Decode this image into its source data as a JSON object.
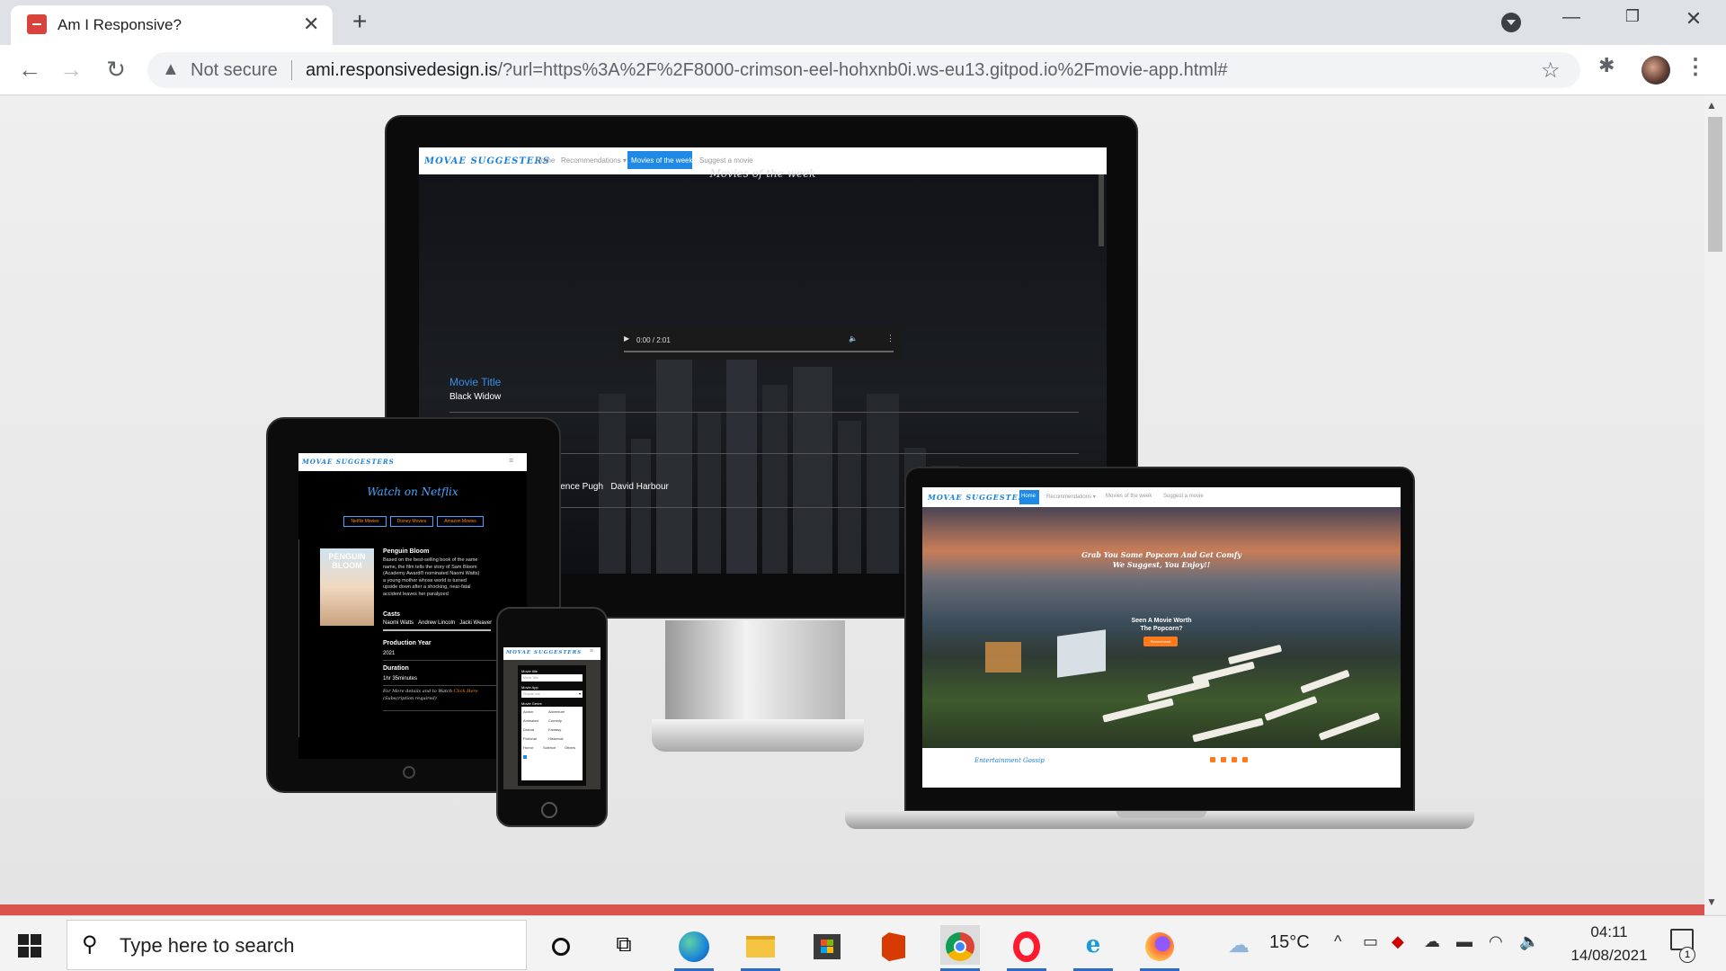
{
  "browser": {
    "tab_title": "Am I Responsive?",
    "tab_close": "✕",
    "new_tab": "+",
    "security_label": "Not secure",
    "url_host": "ami.responsivedesign.is",
    "url_path": "/?url=https%3A%2F%2F8000-crimson-eel-hohxnb0i.ws-eu13.gitpod.io%2Fmovie-app.html#",
    "icons": [
      "back-icon",
      "forward-icon",
      "reload-icon",
      "warning-icon",
      "star-icon",
      "extensions-icon",
      "menu-icon",
      "minimize-icon",
      "restore-icon",
      "close-icon"
    ]
  },
  "site": {
    "brand": "MOVAE SUGGESTERS",
    "nav": [
      "Home",
      "Recommendations ▾",
      "Movies of the week",
      "Suggest a movie"
    ],
    "monitor": {
      "heading": "Movies of the week",
      "video_time": "0:00 / 2:01",
      "movie_title_label": "Movie Title",
      "movie_title_value": "Black Widow",
      "cast": [
        "Florence Pugh",
        "David Harbour"
      ]
    },
    "tablet": {
      "heading": "Watch on Netflix",
      "pills": [
        "Netflix Movies",
        "Disney Movies",
        "Amazon Movies"
      ],
      "poster_text": "PENGUIN BLOOM",
      "film_title": "Penguin Bloom",
      "synopsis": "Based on the best-selling book of the same name, the film tells the story of Sam Bloom (Academy Award® nominated Naomi Watts) a young mother whose world is turned upside down after a shocking, near-fatal accident leaves her paralyzed",
      "casts_label": "Casts",
      "casts": [
        "Naomi Watts",
        "Andrew Lincoln",
        "Jacki Weaver"
      ],
      "year_label": "Production Year",
      "year": "2021",
      "duration_label": "Duration",
      "duration": "1hr 35minutes",
      "more_prefix": "For More details and to Watch ",
      "more_link": "Click Here",
      "more_suffix": "(Subscription required)"
    },
    "phone": {
      "title_label": "Movie title",
      "title_placeholder": "Movie Title",
      "app_label": "Movie App",
      "app_placeholder": "Choose one",
      "genre_label": "Movie Genre",
      "genres": [
        "Action",
        "Adventure",
        "Animated",
        "Comedy",
        "Drama",
        "Fantasy",
        "Fictional",
        "Historical",
        "Horror",
        "Science",
        "Others"
      ]
    },
    "laptop": {
      "tagline_1": "Grab You Some Popcorn And Get Comfy",
      "tagline_2": "We Suggest, You Enjoy!!",
      "seen_1": "Seen A Movie Worth",
      "seen_2": "The Popcorn?",
      "button": "Recommend",
      "footer": "Entertainment Gossip"
    }
  },
  "taskbar": {
    "search_placeholder": "Type here to search",
    "temperature": "15°C",
    "time": "04:11",
    "date": "14/08/2021",
    "notification_count": "1",
    "apps": [
      "cortana-icon",
      "task-view-icon",
      "edge-icon",
      "file-explorer-icon",
      "store-icon",
      "office-icon",
      "chrome-icon",
      "opera-icon",
      "internet-explorer-icon",
      "firefox-icon"
    ]
  },
  "colors": {
    "accent_blue": "#1e8ae6",
    "orange": "#ff7a1a",
    "page_redbar": "#d9534f"
  }
}
